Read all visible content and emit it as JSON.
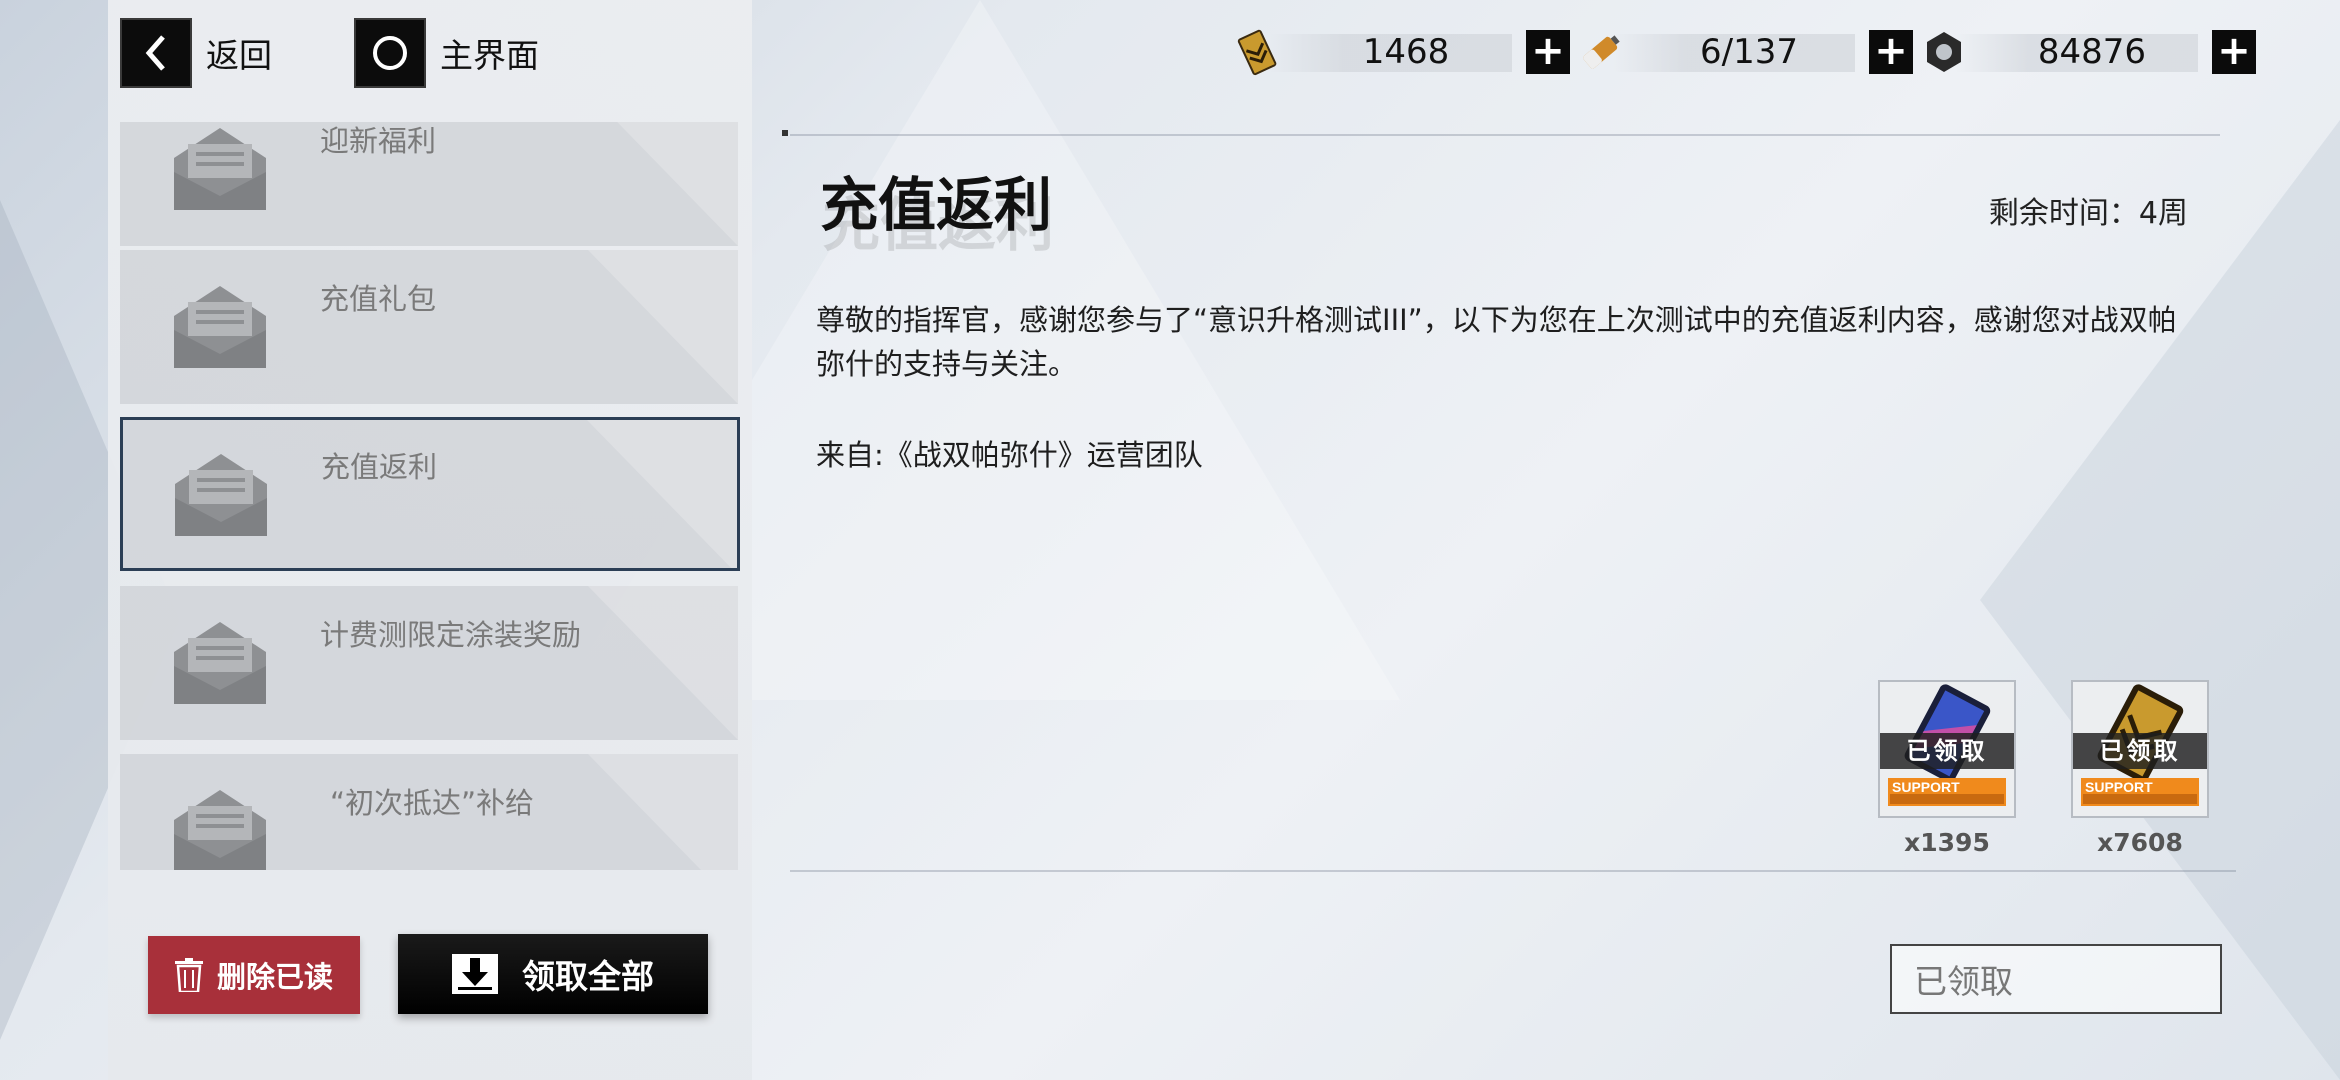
{
  "topbar": {
    "back_label": "返回",
    "home_label": "主界面",
    "resources": [
      {
        "icon": "gold-card-icon",
        "value": "1468"
      },
      {
        "icon": "battery-icon",
        "value": "6/137"
      },
      {
        "icon": "gear-nut-icon",
        "value": "84876"
      }
    ],
    "plus": "+"
  },
  "mail_list": {
    "items": [
      {
        "title": "迎新福利"
      },
      {
        "title": "充值礼包"
      },
      {
        "title": "充值返利"
      },
      {
        "title": "计费测限定涂装奖励"
      },
      {
        "title": "“初次抵达”补给"
      }
    ],
    "delete_read_label": "删除已读",
    "claim_all_label": "领取全部"
  },
  "mail": {
    "title": "充值返利",
    "remaining": "剩余时间：4周",
    "body": "尊敬的指挥官，感谢您参与了“意识升格测试III”，以下为您在上次测试中的充值返利内容，感谢您对战双帕弥什的支持与关注。",
    "from": "来自:《战双帕弥什》运营团队",
    "rewards": [
      {
        "qty": "x1395",
        "status": "已领取",
        "card_label": "SUPPORT"
      },
      {
        "qty": "x7608",
        "status": "已领取",
        "card_label": "SUPPORT"
      }
    ],
    "claimed_button": "已领取"
  },
  "colors": {
    "delete_button": "#a8303a",
    "claim_all_button": "#000000",
    "selected_border": "#2b3e55"
  }
}
